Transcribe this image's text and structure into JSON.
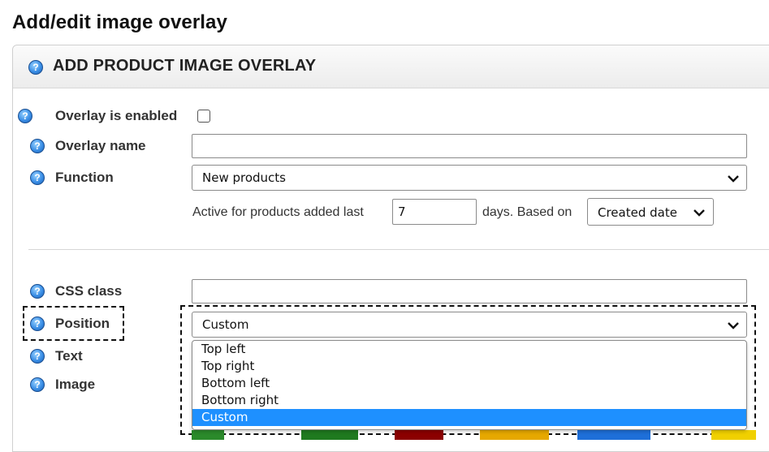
{
  "page": {
    "title": "Add/edit image overlay"
  },
  "panel": {
    "title": "ADD PRODUCT IMAGE OVERLAY",
    "help_icon": "help-question-icon"
  },
  "form": {
    "enabled": {
      "label": "Overlay is enabled",
      "checked": false
    },
    "name": {
      "label": "Overlay name",
      "value": ""
    },
    "function": {
      "label": "Function",
      "selected": "New products",
      "active_prefix": "Active for products added last",
      "days_value": "7",
      "based_on_text": "days. Based on",
      "date_selected": "Created date"
    },
    "css_class": {
      "label": "CSS class",
      "value": ""
    },
    "position": {
      "label": "Position",
      "selected": "Custom",
      "options": [
        "Top left",
        "Top right",
        "Bottom left",
        "Bottom right",
        "Custom"
      ],
      "highlighted_index": 4
    },
    "text": {
      "label": "Text"
    },
    "image": {
      "label": "Image"
    }
  },
  "colors": {
    "accent": "#1e90ff",
    "swatches": [
      "#2b8a2b",
      "#1f7a1f",
      "#8b0000",
      "#e6a800",
      "#1e6fd9",
      "#f0d000"
    ]
  }
}
